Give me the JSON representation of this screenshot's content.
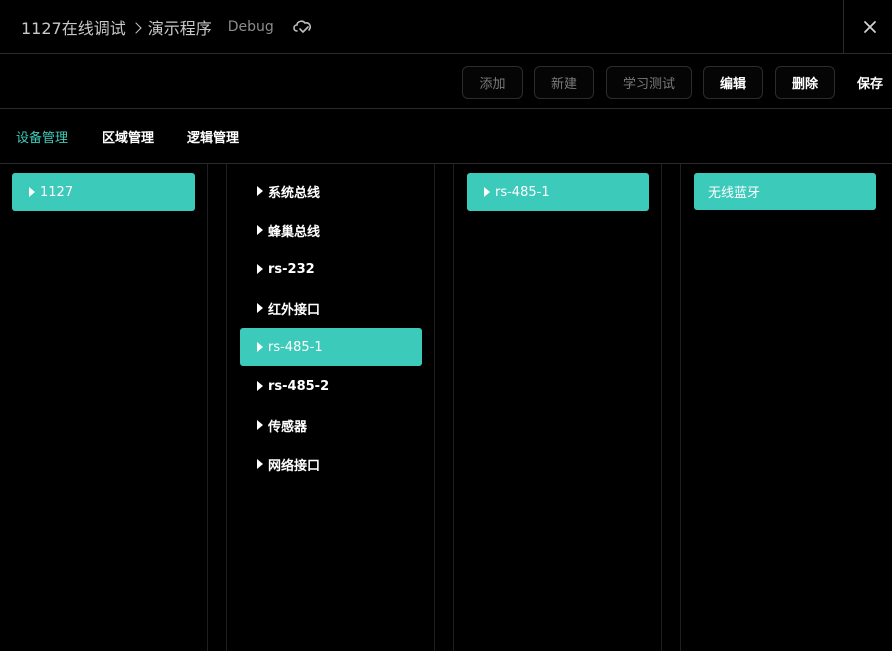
{
  "header": {
    "project": "1127在线调试",
    "program": "演示程序",
    "mode": "Debug"
  },
  "toolbar": {
    "add": "添加",
    "new": "新建",
    "learn_test": "学习测试",
    "edit": "编辑",
    "delete": "删除",
    "save": "保存"
  },
  "tabs": [
    {
      "label": "设备管理"
    },
    {
      "label": "区域管理"
    },
    {
      "label": "逻辑管理"
    }
  ],
  "columns": {
    "devices": [
      {
        "label": "1127"
      }
    ],
    "buses": [
      {
        "label": "系统总线"
      },
      {
        "label": "蜂巢总线"
      },
      {
        "label": "rs-232"
      },
      {
        "label": "红外接口"
      },
      {
        "label": "rs-485-1"
      },
      {
        "label": "rs-485-2"
      },
      {
        "label": "传感器"
      },
      {
        "label": "网络接口"
      }
    ],
    "ports": [
      {
        "label": "rs-485-1"
      }
    ],
    "modules": [
      {
        "label": "无线蓝牙"
      }
    ]
  },
  "colors": {
    "accent": "#3ccabb",
    "tab_active": "#3ecbbb",
    "background": "#000000"
  }
}
